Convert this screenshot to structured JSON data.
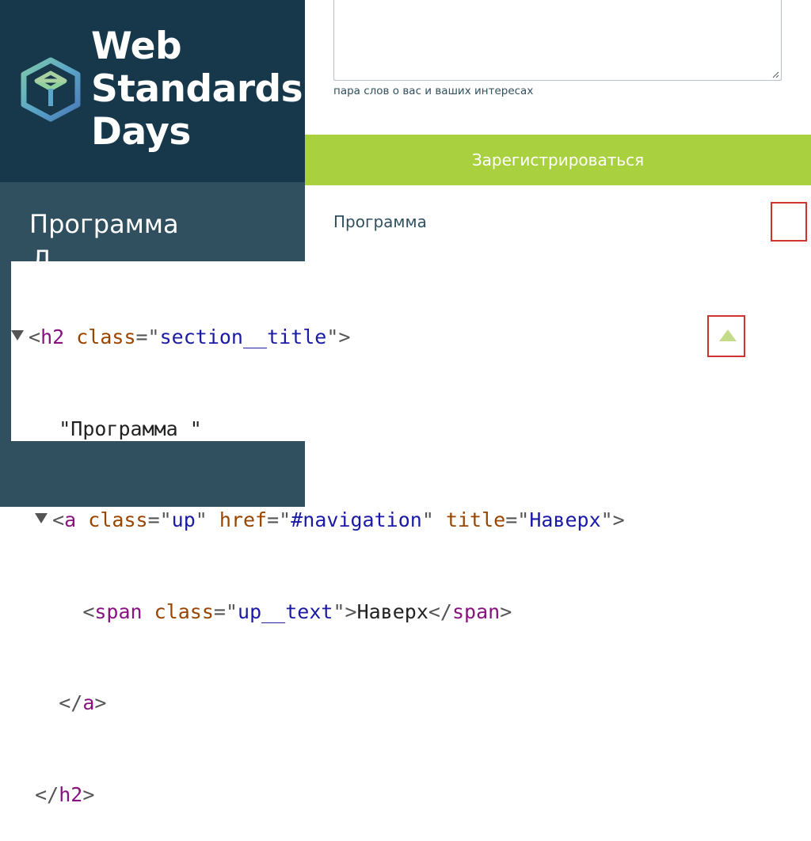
{
  "sidebar": {
    "logo_lines": [
      "Web",
      "Standards",
      "Days"
    ],
    "nav_title": "Программа",
    "nav_cut_glyph": "Д"
  },
  "form": {
    "hint": "пара слов о вас и ваших интересах",
    "submit_label": "Зарегистрироваться"
  },
  "section": {
    "title": "Программа"
  },
  "devtools": {
    "line1": {
      "open": "<",
      "tag": "h2",
      "attr": "class",
      "eq": "=\"",
      "val": "section__title",
      "close": "\">"
    },
    "line2": {
      "text": "\"Программа \""
    },
    "line3": {
      "open": "<",
      "tag": "a",
      "attr1": "class",
      "val1": "up",
      "attr2": "href",
      "val2": "#navigation",
      "attr3": "title",
      "val3": "Наверх",
      "close": "\">"
    },
    "line4": {
      "open": "<",
      "tag": "span",
      "attr": "class",
      "val": "up__text",
      "mid": "\">",
      "text": "Наверх",
      "end_open": "</",
      "end_tag": "span",
      "end_close": ">"
    },
    "line5": {
      "open": "</",
      "tag": "a",
      "close": ">"
    },
    "line6": {
      "open": "</",
      "tag": "h2",
      "close": ">"
    }
  },
  "colors": {
    "sidebar_dark": "#17384a",
    "sidebar_mid": "#30505f",
    "accent_green": "#a9d03f",
    "highlight_red": "#d0342f"
  },
  "icons": [
    "web-standards-days-logo-icon",
    "expand-triangle-icon",
    "up-arrow-icon",
    "resize-grip-icon"
  ]
}
